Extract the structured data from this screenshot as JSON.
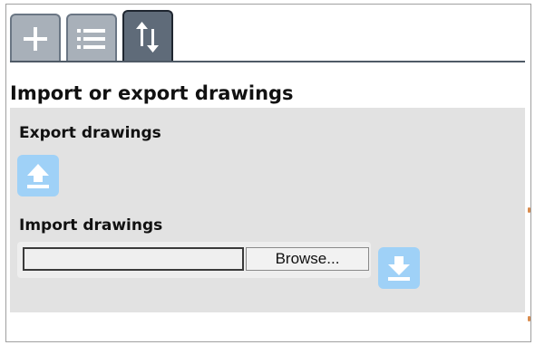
{
  "tabs": [
    {
      "name": "add",
      "icon": "plus-icon",
      "active": false
    },
    {
      "name": "list",
      "icon": "list-icon",
      "active": false
    },
    {
      "name": "import-export",
      "icon": "up-down-arrows-icon",
      "active": true
    }
  ],
  "page": {
    "title": "Import or export drawings"
  },
  "export_section": {
    "heading": "Export drawings",
    "button_icon": "upload-icon"
  },
  "import_section": {
    "heading": "Import drawings",
    "file_value": "",
    "browse_label": "Browse...",
    "button_icon": "download-icon"
  },
  "colors": {
    "tab_inactive": "#a8b0b9",
    "tab_active": "#5f6b79",
    "content_bg": "#e2e2e2",
    "icon_button_bg": "#9fd1f7"
  }
}
